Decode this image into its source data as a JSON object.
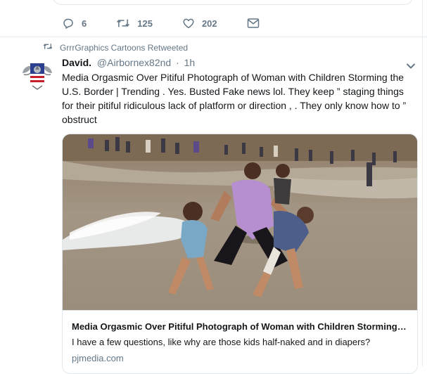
{
  "previous_tweet": {
    "actions": {
      "replies": "6",
      "retweets": "125",
      "likes": "202"
    }
  },
  "tweet": {
    "retweeted_by": "GrrrGraphics Cartoons Retweeted",
    "author_name": "David.",
    "author_handle": "@Airbornex82nd",
    "separator": "·",
    "time": "1h",
    "text": "Media Orgasmic Over Pitiful Photograph of Woman with Children Storming the U.S. Border | Trending . Yes. Busted Fake news lol.  They keep ” staging things for their pitiful ridiculous lack of platform or direction , . They only know how to ” obstruct",
    "card": {
      "title": "Media Orgasmic Over Pitiful Photograph of Woman with Children Storming the U.S. Border | Trending",
      "description": "I have a few questions, like why are those kids half-naked and in diapers?",
      "domain": "pjmedia.com"
    }
  },
  "colors": {
    "text": "#14171a",
    "secondary": "#657786",
    "border": "#e1e8ed"
  },
  "icons": [
    "reply-icon",
    "retweet-icon",
    "like-icon",
    "message-icon",
    "chevron-down-icon"
  ]
}
